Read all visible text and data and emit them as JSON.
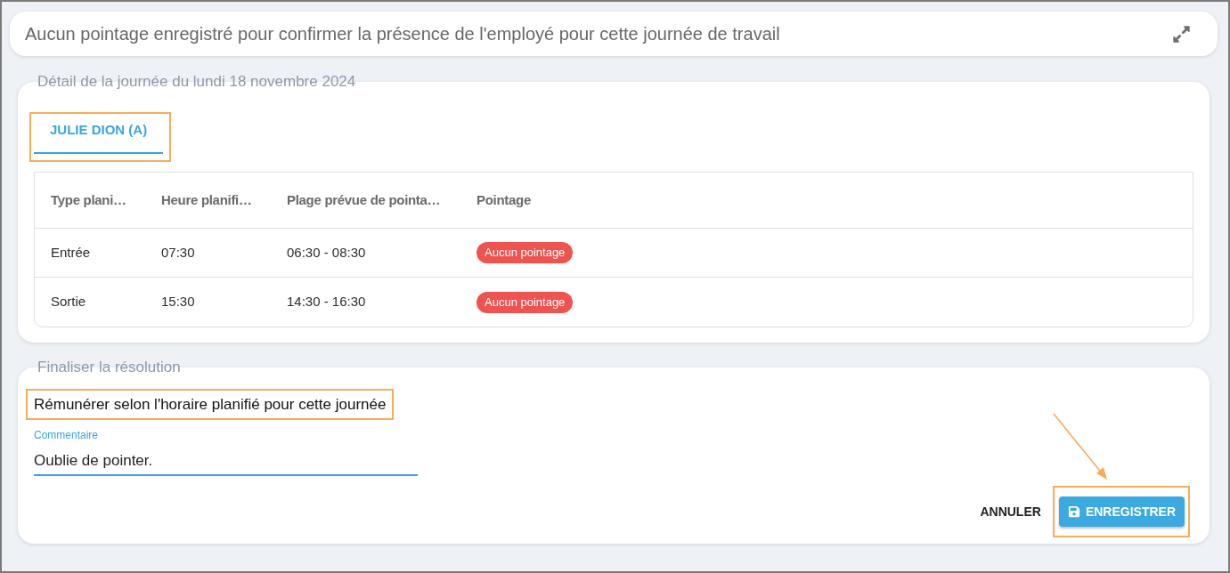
{
  "header": {
    "message": "Aucun pointage enregistré pour confirmer la présence de l'employé pour cette journée de travail"
  },
  "day_detail": {
    "legend": "Détail de la journée du lundi 18 novembre 2024",
    "tabs": [
      {
        "label": "JULIE DION (A)",
        "selected": true,
        "highlighted": true
      }
    ],
    "table": {
      "columns": [
        "Type plani…",
        "Heure planifi…",
        "Plage prévue de pointa…",
        "Pointage"
      ],
      "rows": [
        {
          "cells": [
            "Entrée",
            "07:30",
            "06:30 - 08:30"
          ],
          "status": {
            "label": "Aucun pointage",
            "kind": "missing"
          }
        },
        {
          "cells": [
            "Sortie",
            "15:30",
            "14:30 - 16:30"
          ],
          "status": {
            "label": "Aucun pointage",
            "kind": "missing"
          }
        }
      ]
    }
  },
  "resolution": {
    "legend": "Finaliser la résolution",
    "option": {
      "text": "Rémunérer selon l'horaire planifié pour cette journée",
      "highlighted": true
    },
    "comment": {
      "label": "Commentaire",
      "value": "Oublie de pointer.",
      "focused": true
    },
    "actions": [
      {
        "label": "ANNULER",
        "kind": "text",
        "highlighted": false,
        "pointer_arrow": false
      },
      {
        "label": "ENREGISTRER",
        "kind": "primary",
        "highlighted": true,
        "pointer_arrow": true
      }
    ]
  }
}
